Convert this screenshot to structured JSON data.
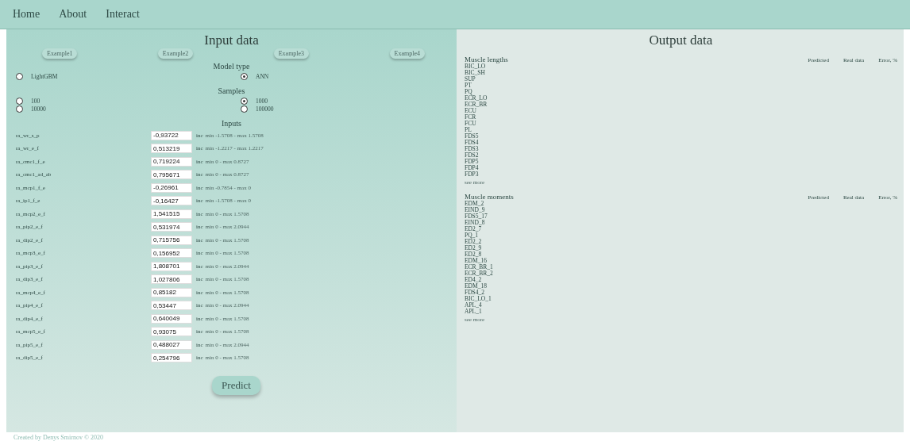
{
  "nav": [
    {
      "label": "Home"
    },
    {
      "label": "About"
    },
    {
      "label": "Interact"
    }
  ],
  "input_panel": {
    "title": "Input data",
    "examples": [
      "Example1",
      "Example2",
      "Example3",
      "Example4"
    ],
    "groups": [
      {
        "title": "Model type",
        "options": [
          {
            "label": "LightGBM",
            "selected": false
          },
          {
            "label": "ANN",
            "selected": true
          }
        ]
      },
      {
        "title": "Samples",
        "options": [
          {
            "label": "100",
            "selected": false
          },
          {
            "label": "1000",
            "selected": true
          },
          {
            "label": "10000",
            "selected": false
          },
          {
            "label": "100000",
            "selected": false
          }
        ]
      }
    ],
    "inputs_title": "Inputs",
    "inputs": [
      {
        "name": "ra_wr_s_p",
        "value": "-0,93722",
        "unit": "inc",
        "range": "min -1.5708 - max 1.5708"
      },
      {
        "name": "ra_wr_e_f",
        "value": "0,513219",
        "unit": "inc",
        "range": "min -1.2217 - max 1.2217"
      },
      {
        "name": "ra_cmc1_f_e",
        "value": "0,719224",
        "unit": "inc",
        "range": "min 0 - max 0.8727"
      },
      {
        "name": "ra_cmc1_ad_ab",
        "value": "0,795671",
        "unit": "inc",
        "range": "min 0 - max 0.8727"
      },
      {
        "name": "ra_mcp1_f_e",
        "value": "-0,26961",
        "unit": "inc",
        "range": "min -0.7854 - max 0"
      },
      {
        "name": "ra_ip1_f_e",
        "value": "-0,16427",
        "unit": "inc",
        "range": "min -1.5708 - max 0"
      },
      {
        "name": "ra_mcp2_e_f",
        "value": "1,541515",
        "unit": "inc",
        "range": "min 0 - max 1.5708"
      },
      {
        "name": "ra_pip2_e_f",
        "value": "0,531974",
        "unit": "inc",
        "range": "min 0 - max 2.0944"
      },
      {
        "name": "ra_dip2_e_f",
        "value": "0,715756",
        "unit": "inc",
        "range": "min 0 - max 1.5708"
      },
      {
        "name": "ra_mcp3_e_f",
        "value": "0,156952",
        "unit": "inc",
        "range": "min 0 - max 1.5708"
      },
      {
        "name": "ra_pip3_e_f",
        "value": "1,808701",
        "unit": "inc",
        "range": "min 0 - max 2.0944"
      },
      {
        "name": "ra_dip3_e_f",
        "value": "1,027806",
        "unit": "inc",
        "range": "min 0 - max 1.5708"
      },
      {
        "name": "ra_mcp4_e_f",
        "value": "0,85182",
        "unit": "inc",
        "range": "min 0 - max 1.5708"
      },
      {
        "name": "ra_pip4_e_f",
        "value": "0,53447",
        "unit": "inc",
        "range": "min 0 - max 2.0944"
      },
      {
        "name": "ra_dip4_e_f",
        "value": "0,640049",
        "unit": "inc",
        "range": "min 0 - max 1.5708"
      },
      {
        "name": "ra_mcp5_e_f",
        "value": "0,93075",
        "unit": "inc",
        "range": "min 0 - max 1.5708"
      },
      {
        "name": "ra_pip5_e_f",
        "value": "0,488027",
        "unit": "inc",
        "range": "min 0 - max 2.0944"
      },
      {
        "name": "ra_dip5_e_f",
        "value": "0,254796",
        "unit": "inc",
        "range": "min 0 - max 1.5708"
      }
    ],
    "predict_button": "Predict"
  },
  "output_panel": {
    "title": "Output data",
    "sections": [
      {
        "title": "Muscle lengths",
        "columns": [
          "Predicted",
          "Real data",
          "Error, %"
        ],
        "items": [
          "BIC_LO",
          "BIC_SH",
          "SUP",
          "PT",
          "PQ",
          "ECR_LO",
          "ECR_BR",
          "ECU",
          "FCR",
          "FCU",
          "PL",
          "FDS5",
          "FDS4",
          "FDS3",
          "FDS2",
          "FDP5",
          "FDP4",
          "FDP3"
        ],
        "more": "see more"
      },
      {
        "title": "Muscle moments",
        "columns": [
          "Predicted",
          "Real data",
          "Error, %"
        ],
        "items": [
          "EDM_2",
          "EIND_9",
          "FDS5_17",
          "EIND_8",
          "ED2_7",
          "PQ_1",
          "ED2_2",
          "ED2_9",
          "ED2_8",
          "EDM_16",
          "ECR_BR_1",
          "ECR_BR_2",
          "ED4_2",
          "EDM_18",
          "FDS4_2",
          "BIC_LO_1",
          "APL_4",
          "APL_1"
        ],
        "more": "see more"
      }
    ]
  },
  "footer": "Created by Denys Smirnov © 2020"
}
